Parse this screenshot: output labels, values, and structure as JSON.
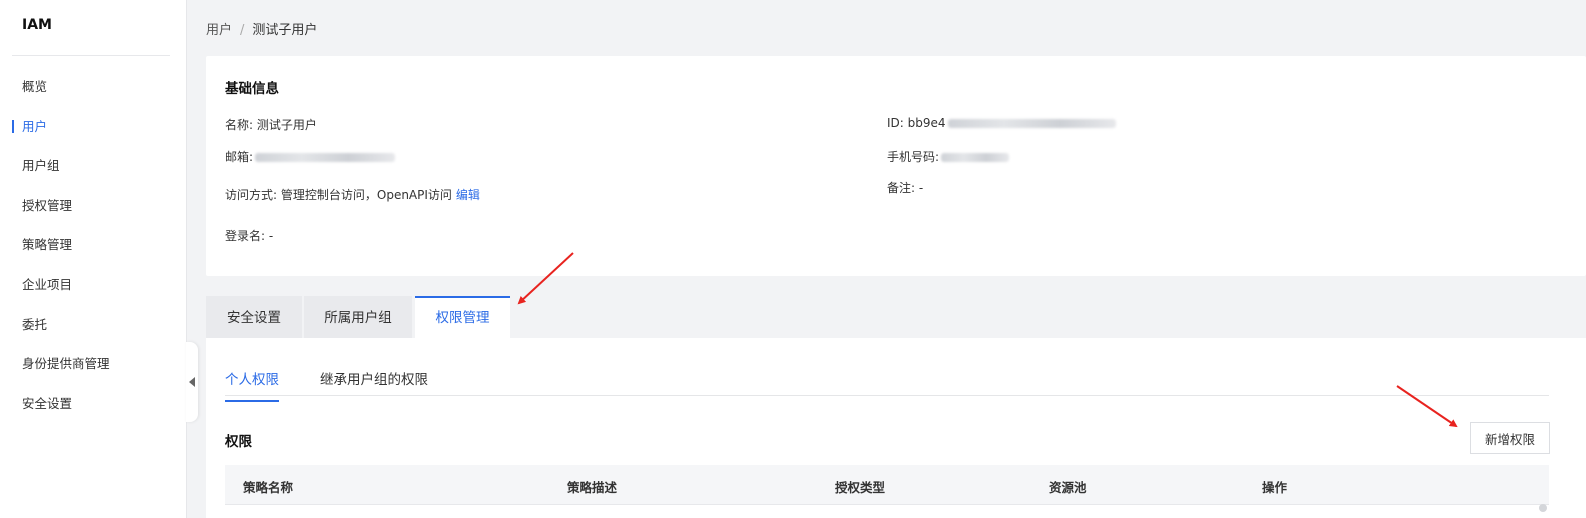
{
  "sidebar": {
    "brand": "IAM",
    "items": [
      {
        "label": "概览"
      },
      {
        "label": "用户"
      },
      {
        "label": "用户组"
      },
      {
        "label": "授权管理"
      },
      {
        "label": "策略管理"
      },
      {
        "label": "企业项目"
      },
      {
        "label": "委托"
      },
      {
        "label": "身份提供商管理"
      },
      {
        "label": "安全设置"
      }
    ],
    "active_index": 1
  },
  "breadcrumb": {
    "parent": "用户",
    "separator": "/",
    "current": "测试子用户"
  },
  "basic_info": {
    "title": "基础信息",
    "name_label": "名称:",
    "name_value": "测试子用户",
    "email_label": "邮箱:",
    "access_label": "访问方式:",
    "access_value": "管理控制台访问，OpenAPI访问",
    "access_edit": "编辑",
    "login_label": "登录名:",
    "login_value": "-",
    "id_label": "ID:",
    "id_value": "bb9e4",
    "phone_label": "手机号码:",
    "note_label": "备注:",
    "note_value": "-"
  },
  "tabs": [
    {
      "label": "安全设置"
    },
    {
      "label": "所属用户组"
    },
    {
      "label": "权限管理"
    }
  ],
  "active_tab": 2,
  "subtabs": [
    {
      "label": "个人权限"
    },
    {
      "label": "继承用户组的权限"
    }
  ],
  "active_subtab": 0,
  "permissions": {
    "title": "权限",
    "add_button": "新增权限",
    "columns": [
      "策略名称",
      "策略描述",
      "授权类型",
      "资源池",
      "操作"
    ]
  },
  "colors": {
    "accent": "#2b6be6",
    "annotation_arrow": "#e8231f"
  }
}
